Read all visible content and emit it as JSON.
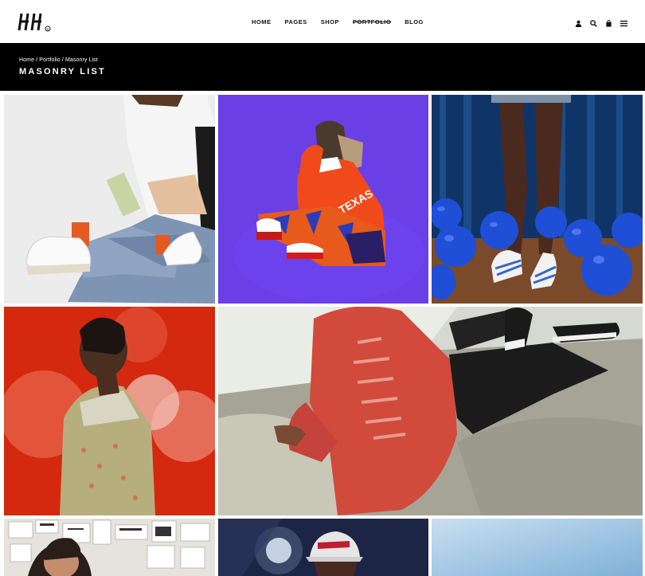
{
  "header": {
    "logo_alt": "HH",
    "nav": [
      {
        "label": "HOME"
      },
      {
        "label": "PAGES"
      },
      {
        "label": "SHOP"
      },
      {
        "label": "PORTFOLIO"
      },
      {
        "label": "BLOG"
      }
    ],
    "icons": [
      "user-icon",
      "search-icon",
      "bag-icon",
      "menu-icon"
    ]
  },
  "titlebar": {
    "breadcrumb": [
      "Home",
      "Portfolio",
      "Masonry List"
    ],
    "breadcrumb_separator": " / ",
    "title": "MASONRY LIST"
  },
  "colors": {
    "accent": "#000000",
    "tile1_bg": "#e9e9e9",
    "tile2_bg": "#6a3fe6",
    "tile3_bg": "#123f7a",
    "tile4_bg": "#d22a12",
    "tile5_bg": "#d9ddd5",
    "tile6_bg": "#e5e3dc",
    "tile7_bg": "#1a2242",
    "tile8_bg": "#9ec4e0"
  }
}
